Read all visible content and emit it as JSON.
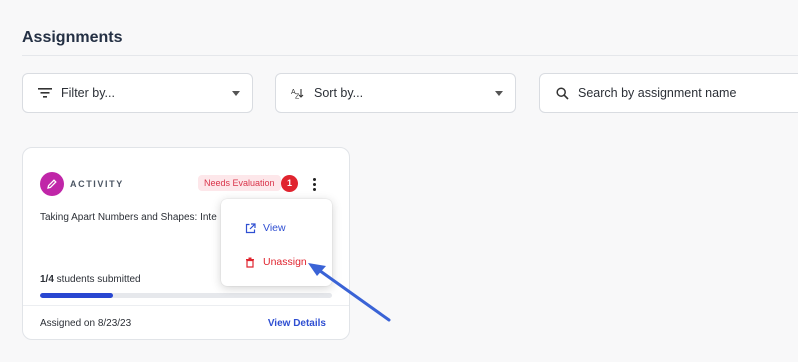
{
  "page": {
    "title": "Assignments"
  },
  "filters": {
    "filter_placeholder": "Filter by...",
    "sort_placeholder": "Sort by...",
    "search_placeholder": "Search by assignment name"
  },
  "card": {
    "type_label": "ACTIVITY",
    "status": "Needs Evaluation",
    "count": "1",
    "title": "Taking Apart Numbers and Shapes: Inte",
    "submitted_count": "1/4",
    "submitted_text": " students submitted",
    "progress": 0.25,
    "assigned_on": "Assigned on 8/23/23",
    "view_details": "View Details"
  },
  "menu": {
    "items": [
      {
        "label": "View",
        "icon": "external-link-icon"
      },
      {
        "label": "Unassign",
        "icon": "trash-icon"
      }
    ]
  },
  "colors": {
    "accent": "#2f4fd2",
    "danger": "#e0242f",
    "badge": "#c026a8",
    "arrow": "#3a63d6"
  }
}
